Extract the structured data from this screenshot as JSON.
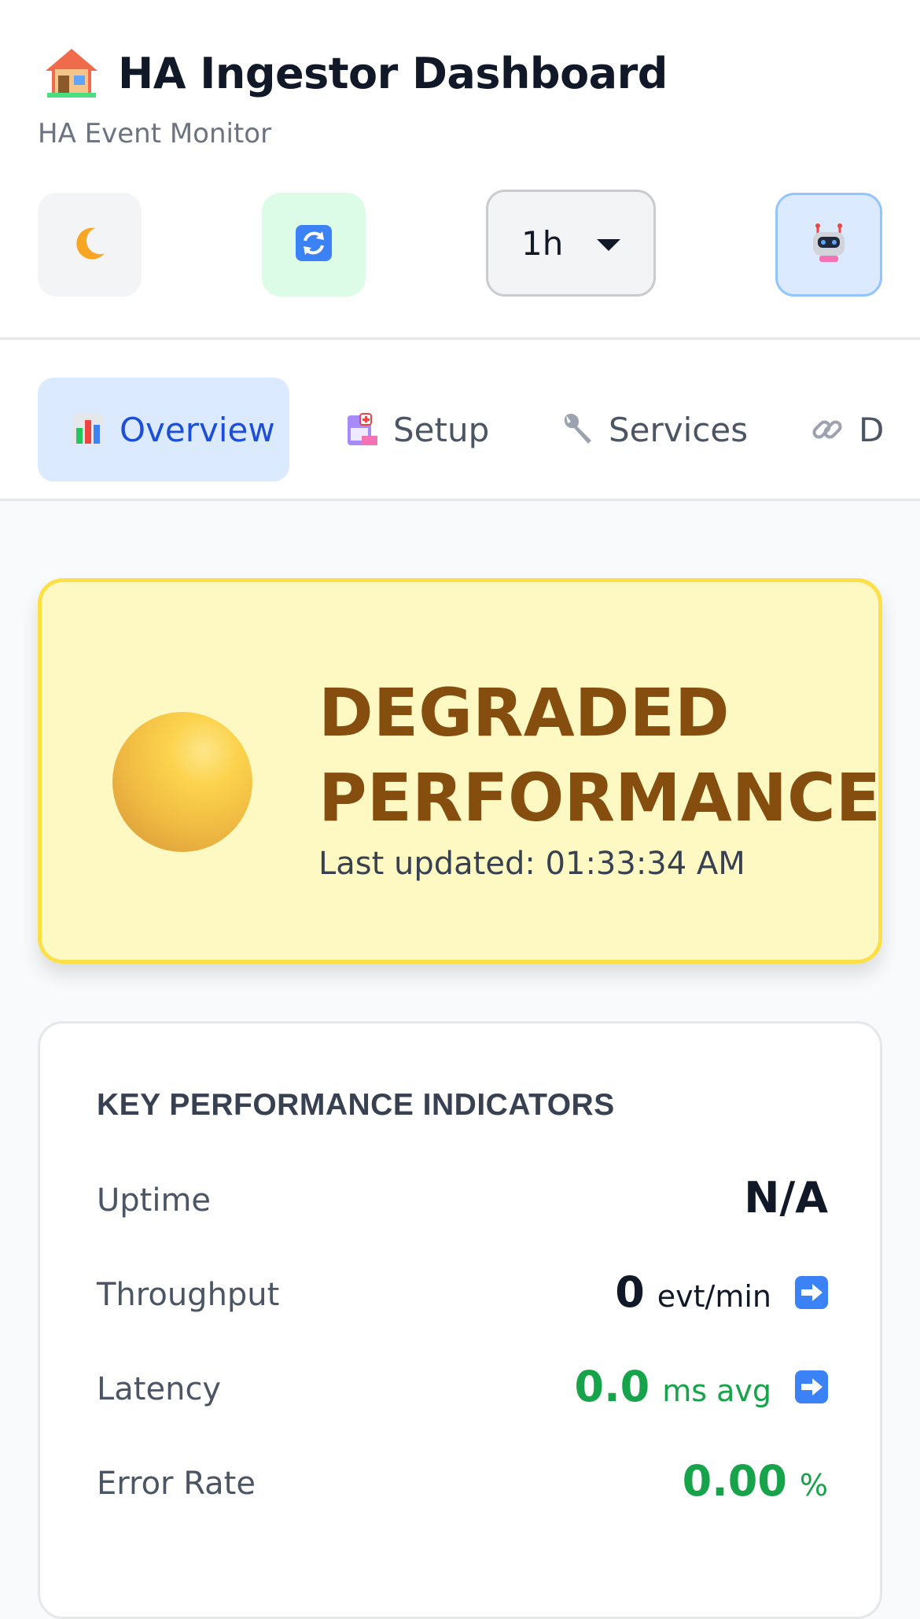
{
  "header": {
    "title": "HA Ingestor Dashboard",
    "subtitle": "HA Event Monitor",
    "title_icon": "house-icon",
    "controls": {
      "theme_icon": "moon-icon",
      "refresh_icon": "refresh-icon",
      "time_range": "1h",
      "ai_icon": "robot-icon"
    }
  },
  "tabs": [
    {
      "label": "Overview",
      "icon": "bar-chart-icon",
      "active": true
    },
    {
      "label": "Setup",
      "icon": "clipboard-icon",
      "active": false
    },
    {
      "label": "Services",
      "icon": "wrench-icon",
      "active": false
    },
    {
      "label": "D",
      "icon": "link-icon",
      "active": false
    }
  ],
  "status": {
    "title_line1": "DEGRADED",
    "title_line2": "PERFORMANCE",
    "last_updated": "Last updated: 01:33:34 AM",
    "color": "#facc15"
  },
  "kpi": {
    "heading": "KEY PERFORMANCE INDICATORS",
    "rows": [
      {
        "label": "Uptime",
        "value": "N/A",
        "unit": ""
      },
      {
        "label": "Throughput",
        "value": "0",
        "unit": "evt/min",
        "trend_icon": "arrow-right-icon"
      },
      {
        "label": "Latency",
        "value": "0.0",
        "unit": "ms avg",
        "trend_icon": "arrow-right-icon"
      },
      {
        "label": "Error Rate",
        "value": "0.00",
        "unit": "%"
      }
    ]
  },
  "colors": {
    "accent": "#1d4ed8",
    "good": "#16a34a",
    "warning_bg": "#fef9c3",
    "warning_text": "#854d0e"
  }
}
